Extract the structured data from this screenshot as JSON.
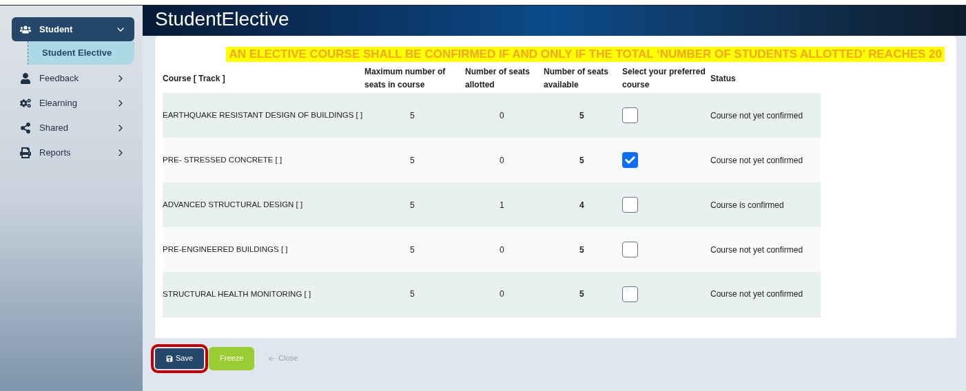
{
  "sidebar": {
    "items": [
      {
        "label": "Student",
        "kind": "users",
        "expanded": true,
        "children": [
          {
            "label": "Student Elective",
            "selected": true
          }
        ]
      },
      {
        "label": "Feedback",
        "kind": "user",
        "expanded": false
      },
      {
        "label": "Elearning",
        "kind": "cogs",
        "expanded": false
      },
      {
        "label": "Shared",
        "kind": "share",
        "expanded": false
      },
      {
        "label": "Reports",
        "kind": "print",
        "expanded": false
      }
    ]
  },
  "page_title": "StudentElective",
  "notice": "AN ELECTIVE COURSE SHALL BE CONFIRMED IF AND ONLY IF THE TOTAL ‘NUMBER OF STUDENTS ALLOTTED’ REACHES 20",
  "table": {
    "columns": [
      "Course [ Track ]",
      "Maximum number of seats in course",
      "Number of seats allotted",
      "Number of seats available",
      "Select your preferred course",
      "Status"
    ],
    "rows": [
      {
        "course": "EARTHQUAKE RESISTANT DESIGN OF BUILDINGS [ ]",
        "max": "5",
        "allotted": "0",
        "available": "5",
        "checked": false,
        "status": "Course not yet confirmed"
      },
      {
        "course": "PRE- STRESSED CONCRETE [ ]",
        "max": "5",
        "allotted": "0",
        "available": "5",
        "checked": true,
        "status": "Course not yet confirmed"
      },
      {
        "course": "ADVANCED STRUCTURAL DESIGN [ ]",
        "max": "5",
        "allotted": "1",
        "available": "4",
        "checked": false,
        "status": "Course is confirmed"
      },
      {
        "course": "PRE-ENGINEERED BUILDINGS [ ]",
        "max": "5",
        "allotted": "0",
        "available": "5",
        "checked": false,
        "status": "Course not yet confirmed"
      },
      {
        "course": "STRUCTURAL HEALTH MONITORING [ ]",
        "max": "5",
        "allotted": "0",
        "available": "5",
        "checked": false,
        "status": "Course not yet confirmed"
      }
    ]
  },
  "buttons": [
    {
      "kind": "save",
      "label": "Save",
      "highlighted": true
    },
    {
      "kind": "freeze",
      "label": "Freeze",
      "highlighted": false
    },
    {
      "kind": "close",
      "label": "Close",
      "highlighted": false
    }
  ]
}
